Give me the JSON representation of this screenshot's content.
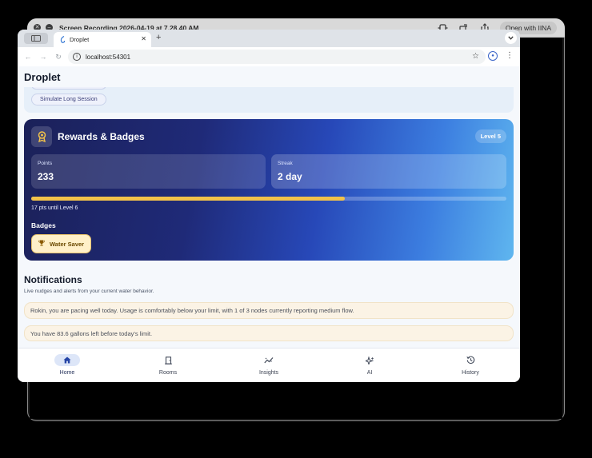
{
  "window": {
    "title": "Screen Recording 2026-04-19 at 7.28.40 AM",
    "open_with_label": "Open with IINA"
  },
  "browser": {
    "tab_title": "Droplet",
    "url": "localhost:54301"
  },
  "app": {
    "title": "Droplet",
    "simulate_button": "Simulate Long Session",
    "rewards": {
      "title": "Rewards & Badges",
      "level_badge": "Level 5",
      "points_label": "Points",
      "points_value": "233",
      "streak_label": "Streak",
      "streak_value": "2 day",
      "progress_fraction": 0.66,
      "progress_text": "17 pts until Level 6",
      "badges_heading": "Badges",
      "badges": [
        "Water Saver"
      ],
      "accent_color": "#f2c24a"
    },
    "notifications": {
      "title": "Notifications",
      "subtitle": "Live nudges and alerts from your current water behavior.",
      "items": [
        "Rokin, you are pacing well today. Usage is comfortably below your limit, with 1 of 3 nodes currently reporting medium flow.",
        "You have 83.6 gallons left before today's limit."
      ]
    },
    "bottom_nav": [
      {
        "label": "Home",
        "icon": "home-icon",
        "active": true
      },
      {
        "label": "Rooms",
        "icon": "door-icon",
        "active": false
      },
      {
        "label": "Insights",
        "icon": "insights-icon",
        "active": false
      },
      {
        "label": "AI",
        "icon": "sparkle-icon",
        "active": false
      },
      {
        "label": "History",
        "icon": "history-icon",
        "active": false
      }
    ]
  }
}
